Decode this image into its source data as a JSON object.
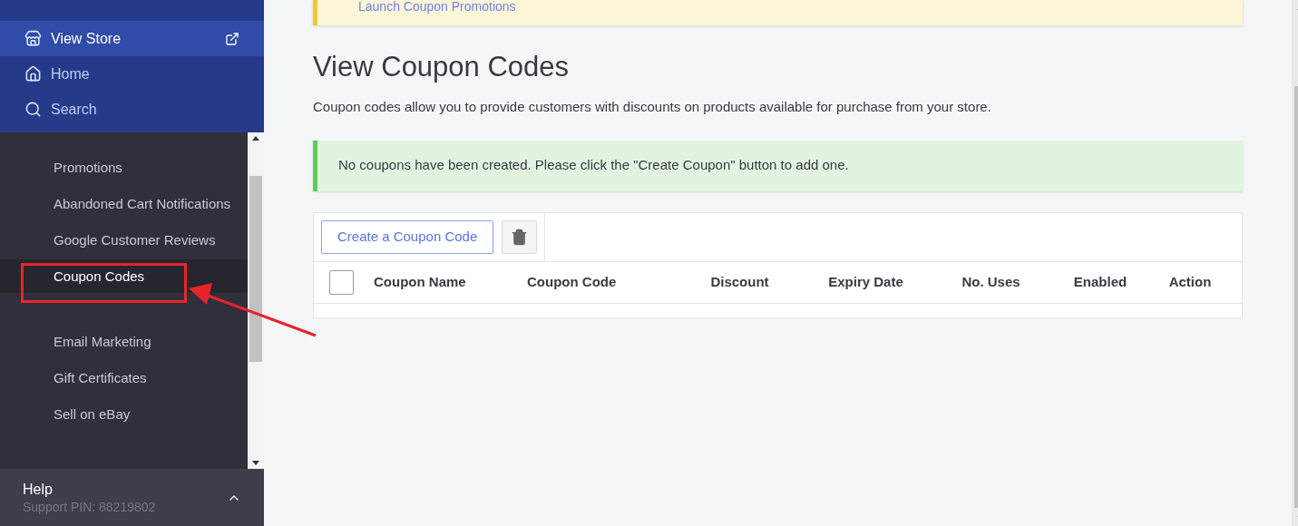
{
  "sidebar": {
    "nav": [
      {
        "label": "View Store",
        "external": true,
        "selected": true
      },
      {
        "label": "Home",
        "external": false,
        "selected": false
      },
      {
        "label": "Search",
        "external": false,
        "selected": false
      }
    ],
    "items": [
      {
        "label": "Promotions",
        "selected": false
      },
      {
        "label": "Abandoned Cart Notifications",
        "selected": false
      },
      {
        "label": "Google Customer Reviews",
        "selected": false
      },
      {
        "label": "Coupon Codes",
        "selected": true
      },
      {
        "label": "Email Marketing",
        "selected": false
      },
      {
        "label": "Gift Certificates",
        "selected": false
      },
      {
        "label": "Sell on eBay",
        "selected": false
      }
    ],
    "footer": {
      "title": "Help",
      "subtitle": "Support PIN: 88219802"
    }
  },
  "banner": {
    "link": "Launch Coupon Promotions"
  },
  "page": {
    "title": "View Coupon Codes",
    "description": "Coupon codes allow you to provide customers with discounts on products available for purchase from your store."
  },
  "alert": {
    "text": "No coupons have been created. Please click the \"Create Coupon\" button to add one."
  },
  "table": {
    "create_button": "Create a Coupon Code",
    "select_all": {
      "checked": false
    },
    "columns": [
      "Coupon Name",
      "Coupon Code",
      "Discount",
      "Expiry Date",
      "No. Uses",
      "Enabled",
      "Action"
    ]
  }
}
